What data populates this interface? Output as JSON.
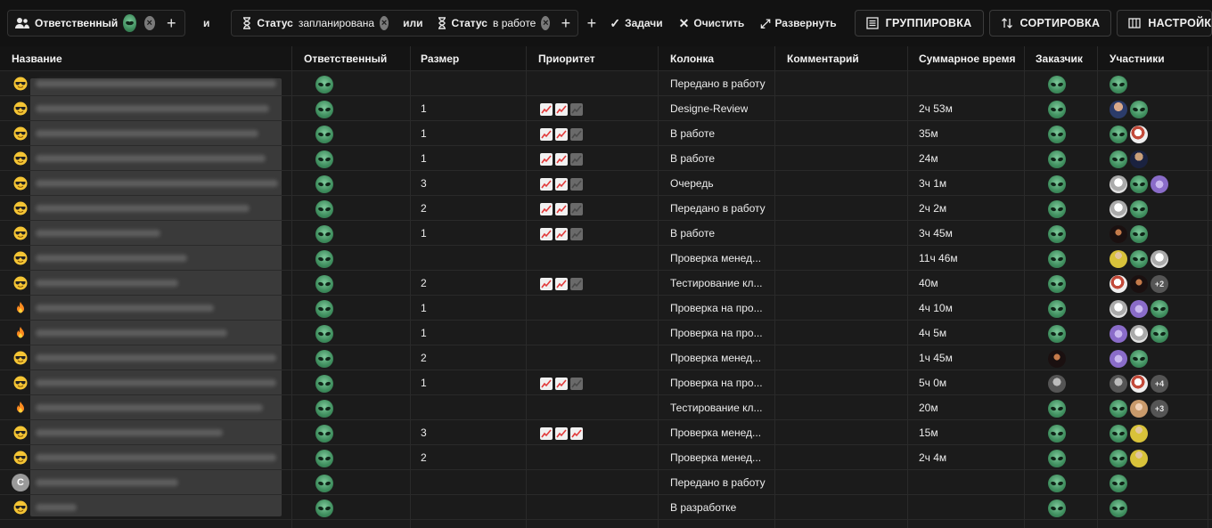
{
  "toolbar": {
    "filter_assignee_label": "Ответственный",
    "conj_and": "и",
    "filter_status1_label": "Статус",
    "filter_status1_value": "запланирована",
    "conj_or": "или",
    "filter_status2_label": "Статус",
    "filter_status2_value": "в работе",
    "tasks_label": "Задачи",
    "clear_label": "Очистить",
    "expand_label": "Развернуть",
    "grouping_label": "ГРУППИРОВКА",
    "sorting_label": "СОРТИРОВКА",
    "settings_label": "НАСТРОЙКА ПОЛ"
  },
  "columns": [
    "Название",
    "Ответственный",
    "Размер",
    "Приоритет",
    "Колонка",
    "Комментарий",
    "Суммарное время",
    "Заказчик",
    "Участники"
  ],
  "rows": [
    {
      "icon": "sunglasses-emoji",
      "size": "",
      "priority": [],
      "column": "Передано в работу",
      "time": "",
      "customer": "alien",
      "members": [
        "alien"
      ]
    },
    {
      "icon": "sunglasses-emoji",
      "size": "1",
      "priority": [
        1,
        1,
        0
      ],
      "column": "Designe-Review",
      "time": "2ч 53м",
      "customer": "alien",
      "members": [
        "photo1",
        "alien"
      ]
    },
    {
      "icon": "sunglasses-emoji",
      "size": "1",
      "priority": [
        1,
        1,
        0
      ],
      "column": "В работе",
      "time": "35м",
      "customer": "alien",
      "members": [
        "alien",
        "photo2"
      ]
    },
    {
      "icon": "sunglasses-emoji",
      "size": "1",
      "priority": [
        1,
        1,
        0
      ],
      "column": "В работе",
      "time": "24м",
      "customer": "alien",
      "members": [
        "alien",
        "photo3"
      ]
    },
    {
      "icon": "sunglasses-emoji",
      "size": "3",
      "priority": [
        1,
        1,
        0
      ],
      "column": "Очередь",
      "time": "3ч 1м",
      "customer": "alien",
      "members": [
        "photo4",
        "alien",
        "violet"
      ]
    },
    {
      "icon": "sunglasses-emoji",
      "size": "2",
      "priority": [
        1,
        1,
        0
      ],
      "column": "Передано в работу",
      "time": "2ч 2м",
      "customer": "alien",
      "members": [
        "photo4",
        "alien"
      ]
    },
    {
      "icon": "sunglasses-emoji",
      "size": "1",
      "priority": [
        1,
        1,
        0
      ],
      "column": "В работе",
      "time": "3ч 45м",
      "customer": "alien",
      "members": [
        "dark",
        "alien"
      ]
    },
    {
      "icon": "sunglasses-emoji",
      "size": "",
      "priority": [],
      "column": "Проверка менед...",
      "time": "11ч 46м",
      "customer": "alien",
      "members": [
        "yellow",
        "alien",
        "photo4"
      ]
    },
    {
      "icon": "sunglasses-emoji",
      "size": "2",
      "priority": [
        1,
        1,
        0
      ],
      "column": "Тестирование кл...",
      "time": "40м",
      "customer": "alien",
      "members": [
        "photo2",
        "dark"
      ],
      "more": "+2"
    },
    {
      "icon": "fire-emoji",
      "size": "1",
      "priority": [],
      "column": "Проверка на про...",
      "time": "4ч 10м",
      "customer": "alien",
      "members": [
        "photo4",
        "violet",
        "alien"
      ]
    },
    {
      "icon": "fire-emoji",
      "size": "1",
      "priority": [],
      "column": "Проверка на про...",
      "time": "4ч 5м",
      "customer": "alien",
      "members": [
        "violet",
        "photo4",
        "alien"
      ]
    },
    {
      "icon": "sunglasses-emoji",
      "size": "2",
      "priority": [],
      "column": "Проверка менед...",
      "time": "1ч 45м",
      "customer": "dark",
      "members": [
        "violet",
        "alien"
      ]
    },
    {
      "icon": "sunglasses-emoji",
      "size": "1",
      "priority": [
        1,
        1,
        0
      ],
      "column": "Проверка на про...",
      "time": "5ч 0м",
      "customer": "grey",
      "members": [
        "grey",
        "photo2"
      ],
      "more": "+4"
    },
    {
      "icon": "fire-emoji",
      "size": "",
      "priority": [],
      "column": "Тестирование кл...",
      "time": "20м",
      "customer": "alien",
      "members": [
        "alien",
        "girl"
      ],
      "more": "+3"
    },
    {
      "icon": "sunglasses-emoji",
      "size": "3",
      "priority": [
        1,
        1,
        1
      ],
      "column": "Проверка менед...",
      "time": "15м",
      "customer": "alien",
      "members": [
        "alien",
        "yellow"
      ]
    },
    {
      "icon": "sunglasses-emoji",
      "size": "2",
      "priority": [],
      "column": "Проверка менед...",
      "time": "2ч 4м",
      "customer": "alien",
      "members": [
        "alien",
        "yellow"
      ]
    },
    {
      "icon": "letter",
      "letter": "C",
      "size": "",
      "priority": [],
      "column": "Передано в работу",
      "time": "",
      "customer": "alien",
      "members": [
        "alien"
      ]
    },
    {
      "icon": "sunglasses-emoji",
      "size": "",
      "priority": [],
      "column": "В разработке",
      "time": "",
      "customer": "alien",
      "members": [
        "alien"
      ]
    }
  ]
}
